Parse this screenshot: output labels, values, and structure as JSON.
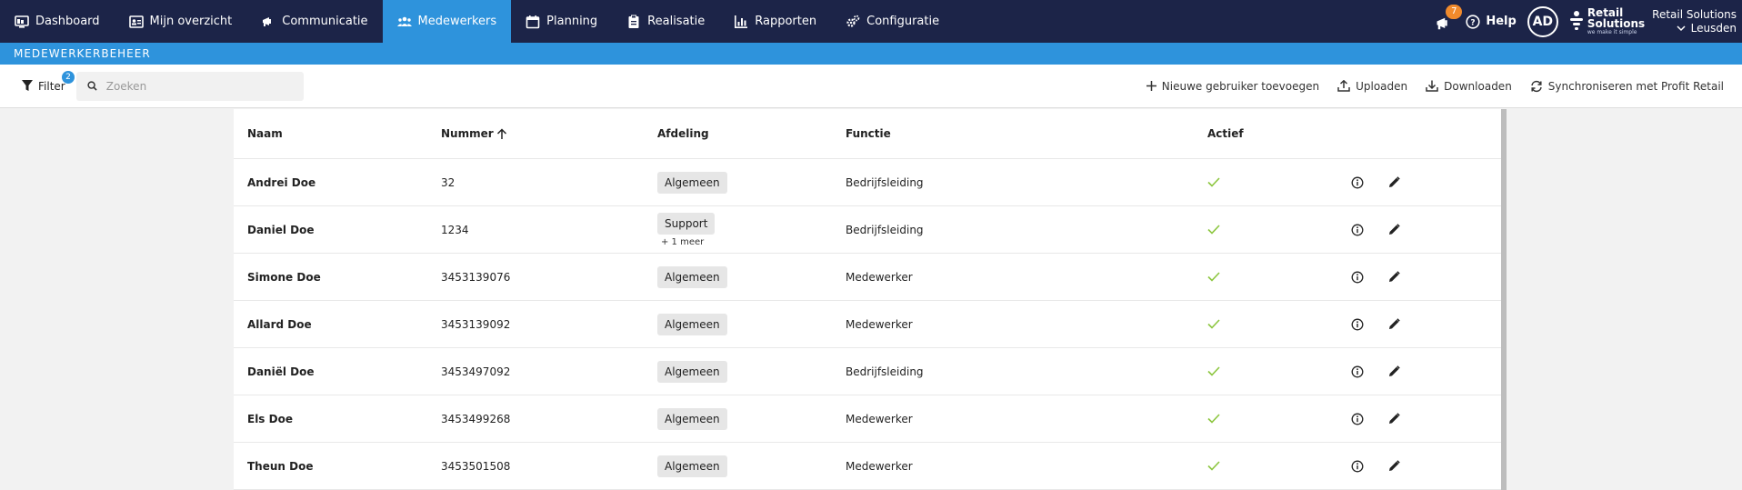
{
  "nav": {
    "items": [
      {
        "label": "Dashboard",
        "icon": "monitor-icon"
      },
      {
        "label": "Mijn overzicht",
        "icon": "id-card-icon"
      },
      {
        "label": "Communicatie",
        "icon": "megaphone-icon"
      },
      {
        "label": "Medewerkers",
        "icon": "users-icon",
        "active": true
      },
      {
        "label": "Planning",
        "icon": "calendar-icon"
      },
      {
        "label": "Realisatie",
        "icon": "clipboard-icon"
      },
      {
        "label": "Rapporten",
        "icon": "bar-chart-icon"
      },
      {
        "label": "Configuratie",
        "icon": "gears-icon"
      }
    ],
    "notification_count": "7",
    "help_label": "Help",
    "avatar_initials": "AD",
    "brand_line1": "Retail",
    "brand_line2": "Solutions",
    "brand_tagline": "we make it simple",
    "org_name": "Retail Solutions",
    "org_location": "Leusden"
  },
  "subheader": {
    "title": "MEDEWERKERBEHEER"
  },
  "toolbar": {
    "filter_label": "Filter",
    "filter_count": "2",
    "search_placeholder": "Zoeken",
    "search_value": "",
    "add_user_label": "Nieuwe gebruiker toevoegen",
    "upload_label": "Uploaden",
    "download_label": "Downloaden",
    "sync_label": "Synchroniseren met Profit Retail"
  },
  "table": {
    "headers": {
      "naam": "Naam",
      "nummer": "Nummer",
      "afdeling": "Afdeling",
      "functie": "Functie",
      "actief": "Actief"
    },
    "rows": [
      {
        "naam": "Andrei Doe",
        "nummer": "32",
        "afdeling": "Algemeen",
        "extra": "",
        "functie": "Bedrijfsleiding",
        "actief": true
      },
      {
        "naam": "Daniel Doe",
        "nummer": "1234",
        "afdeling": "Support",
        "extra": "+ 1 meer",
        "functie": "Bedrijfsleiding",
        "actief": true
      },
      {
        "naam": "Simone Doe",
        "nummer": "3453139076",
        "afdeling": "Algemeen",
        "extra": "",
        "functie": "Medewerker",
        "actief": true
      },
      {
        "naam": "Allard Doe",
        "nummer": "3453139092",
        "afdeling": "Algemeen",
        "extra": "",
        "functie": "Medewerker",
        "actief": true
      },
      {
        "naam": "Daniël Doe",
        "nummer": "3453497092",
        "afdeling": "Algemeen",
        "extra": "",
        "functie": "Bedrijfsleiding",
        "actief": true
      },
      {
        "naam": "Els Doe",
        "nummer": "3453499268",
        "afdeling": "Algemeen",
        "extra": "",
        "functie": "Medewerker",
        "actief": true
      },
      {
        "naam": "Theun Doe",
        "nummer": "3453501508",
        "afdeling": "Algemeen",
        "extra": "",
        "functie": "Medewerker",
        "actief": true
      }
    ]
  },
  "colors": {
    "topbar": "#1c2448",
    "accent": "#2e93dc",
    "badge": "#f08a2c",
    "check": "#8cc63f"
  }
}
